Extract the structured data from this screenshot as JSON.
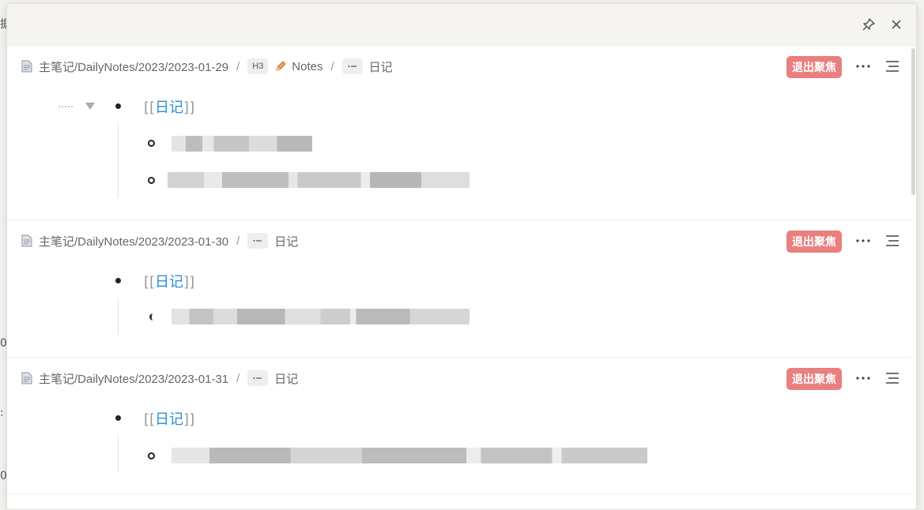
{
  "background_fragments": [
    "据",
    "0",
    ":",
    "0"
  ],
  "header": {
    "pin_icon": "pin-icon",
    "close_icon": "close-icon"
  },
  "blocks": [
    {
      "path": "主笔记/DailyNotes/2023/2023-01-29",
      "separator": "/",
      "heading_chip": "H3",
      "notes_label": "Notes",
      "tag_label": "日记",
      "focus_label": "退出聚焦",
      "link_open": "[[",
      "link_text": "日记",
      "link_close": "]]"
    },
    {
      "path": "主笔记/DailyNotes/2023/2023-01-30",
      "separator": "/",
      "tag_label": "日记",
      "focus_label": "退出聚焦",
      "link_open": "[[",
      "link_text": "日记",
      "link_close": "]]"
    },
    {
      "path": "主笔记/DailyNotes/2023/2023-01-31",
      "separator": "/",
      "tag_label": "日记",
      "focus_label": "退出聚焦",
      "link_open": "[[",
      "link_text": "日记",
      "link_close": "]]"
    }
  ],
  "colors": {
    "focus_button": "#e97f7f",
    "link": "#2b8fd6",
    "header_bg": "#f5f4f0"
  }
}
